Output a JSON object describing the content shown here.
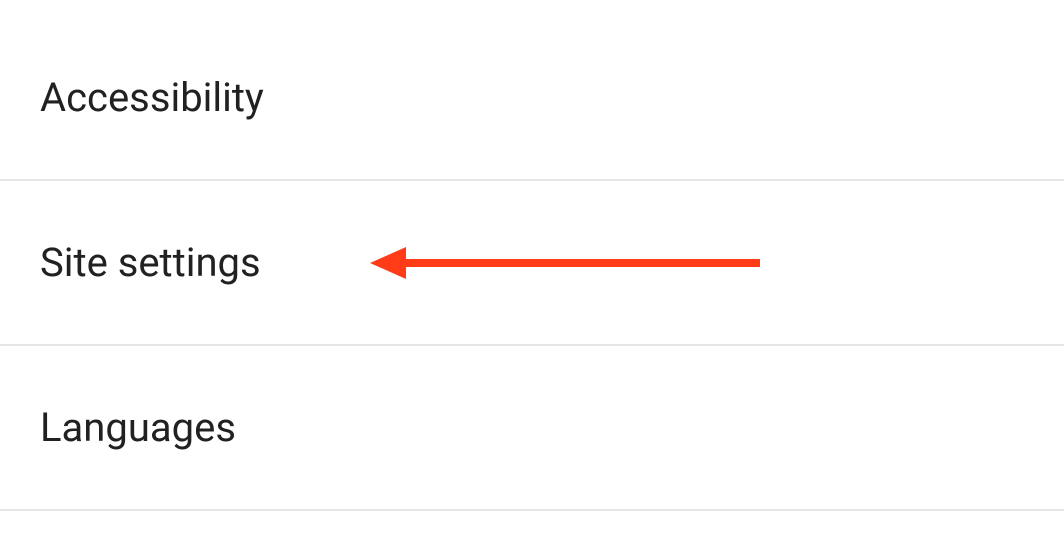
{
  "settings": {
    "items": [
      {
        "label": "Accessibility"
      },
      {
        "label": "Site settings"
      },
      {
        "label": "Languages"
      }
    ]
  },
  "annotation": {
    "color": "#ff3b18",
    "target_index": 1
  }
}
